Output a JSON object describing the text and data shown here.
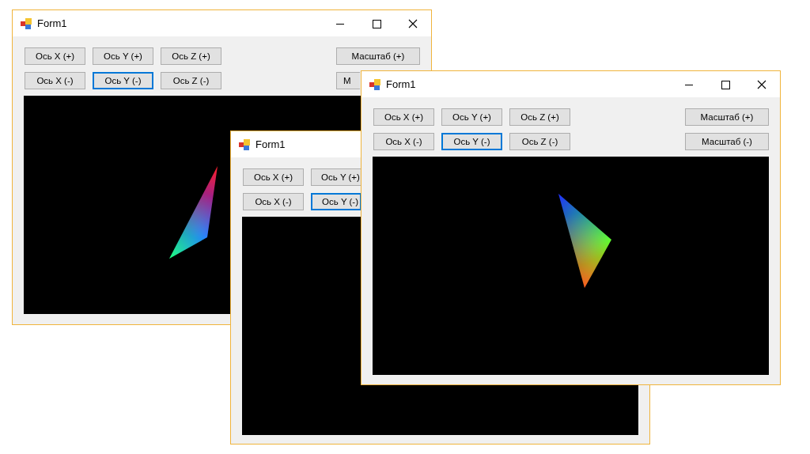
{
  "windows": [
    {
      "title": "Form1",
      "caption_buttons": true,
      "axis_rows": [
        [
          {
            "label": "Ось X (+)",
            "focused": false,
            "cut": false
          },
          {
            "label": "Ось Y (+)",
            "focused": false,
            "cut": false
          },
          {
            "label": "Ось Z (+)",
            "focused": false,
            "cut": false
          }
        ],
        [
          {
            "label": "Ось X (-)",
            "focused": false,
            "cut": false
          },
          {
            "label": "Ось Y (-)",
            "focused": true,
            "cut": false
          },
          {
            "label": "Ось Z (-)",
            "focused": false,
            "cut": false
          }
        ]
      ],
      "scale_buttons": [
        {
          "label": "Масштаб (+)",
          "cut": false
        },
        {
          "label": "М",
          "cut": true
        }
      ],
      "triangle": true
    },
    {
      "title": "Form1",
      "caption_buttons": false,
      "axis_rows": [
        [
          {
            "label": "Ось X (+)",
            "focused": false,
            "cut": false
          },
          {
            "label": "Ось Y (+)",
            "focused": false,
            "cut": true
          }
        ],
        [
          {
            "label": "Ось X (-)",
            "focused": false,
            "cut": false
          },
          {
            "label": "Ось Y (-)",
            "focused": true,
            "cut": true
          }
        ]
      ],
      "triangle": false
    },
    {
      "title": "Form1",
      "caption_buttons": true,
      "axis_rows": [
        [
          {
            "label": "Ось X (+)",
            "focused": false,
            "cut": false
          },
          {
            "label": "Ось Y (+)",
            "focused": false,
            "cut": false
          },
          {
            "label": "Ось Z (+)",
            "focused": false,
            "cut": false
          }
        ],
        [
          {
            "label": "Ось X (-)",
            "focused": false,
            "cut": false
          },
          {
            "label": "Ось Y (-)",
            "focused": true,
            "cut": false
          },
          {
            "label": "Ось Z (-)",
            "focused": false,
            "cut": false
          }
        ]
      ],
      "scale_buttons": [
        {
          "label": "Масштаб (+)",
          "cut": false
        },
        {
          "label": "Масштаб (-)",
          "cut": false
        }
      ],
      "triangle": true
    }
  ]
}
